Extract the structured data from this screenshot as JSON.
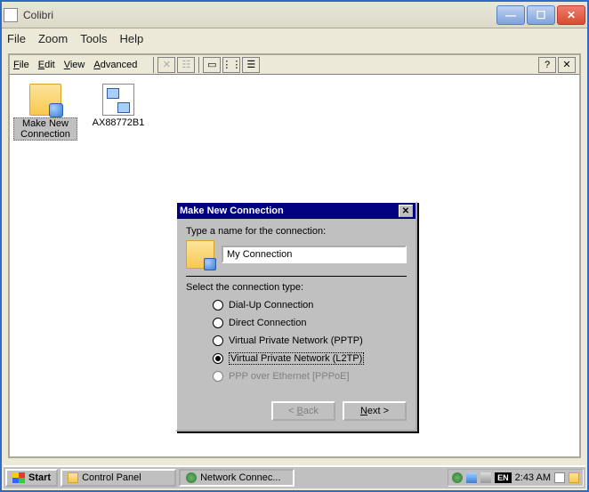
{
  "outer": {
    "title": "Colibri"
  },
  "outer_menu": [
    "File",
    "Zoom",
    "Tools",
    "Help"
  ],
  "inner_menu": {
    "file": "File",
    "edit": "Edit",
    "view": "View",
    "advanced": "Advanced"
  },
  "help_btn": "?",
  "desktop_icons": {
    "make_new": "Make New Connection",
    "device": "AX88772B1"
  },
  "dialog": {
    "title": "Make New Connection",
    "name_prompt": "Type a name for the connection:",
    "name_value": "My Connection",
    "type_prompt": "Select the connection type:",
    "options": {
      "dialup": "Dial-Up Connection",
      "direct": "Direct Connection",
      "pptp": "Virtual Private Network (PPTP)",
      "l2tp": "Virtual Private Network (L2TP)",
      "pppoe": "PPP over Ethernet [PPPoE]"
    },
    "back": "< Back",
    "next": "Next >"
  },
  "taskbar": {
    "start": "Start",
    "tasks": {
      "cp": "Control Panel",
      "nc": "Network Connec..."
    },
    "lang": "EN",
    "clock": "2:43 AM"
  }
}
